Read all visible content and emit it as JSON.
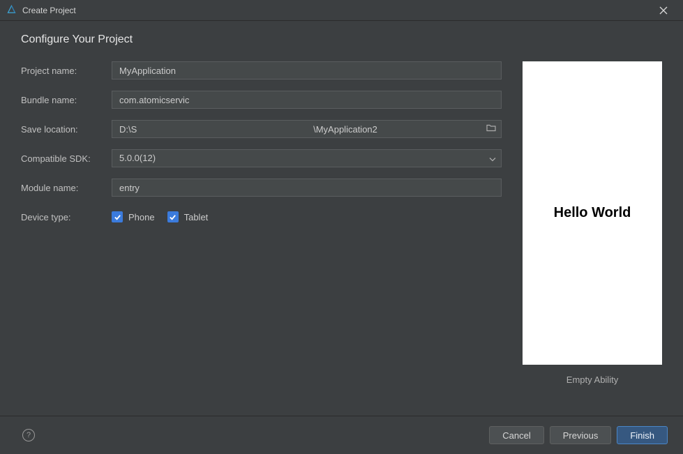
{
  "window": {
    "title": "Create Project"
  },
  "heading": "Configure Your Project",
  "form": {
    "project_name": {
      "label": "Project name:",
      "value": "MyApplication"
    },
    "bundle_name": {
      "label": "Bundle name:",
      "value": "com.atomicservic"
    },
    "save_location": {
      "label": "Save location:",
      "value": "D:\\S                                                                      \\MyApplication2"
    },
    "compatible_sdk": {
      "label": "Compatible SDK:",
      "value": "5.0.0(12)"
    },
    "module_name": {
      "label": "Module name:",
      "value": "entry"
    },
    "device_type": {
      "label": "Device type:",
      "options": [
        {
          "label": "Phone",
          "checked": true
        },
        {
          "label": "Tablet",
          "checked": true
        }
      ]
    }
  },
  "preview": {
    "content_text": "Hello World",
    "caption": "Empty Ability"
  },
  "footer": {
    "cancel": "Cancel",
    "previous": "Previous",
    "finish": "Finish"
  }
}
